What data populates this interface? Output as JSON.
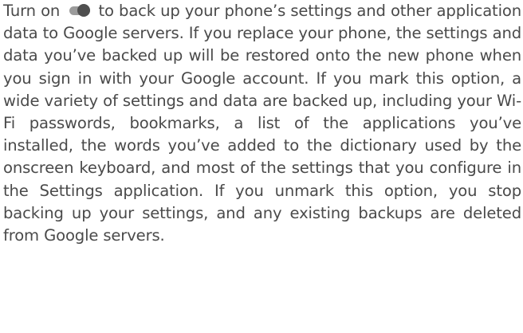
{
  "paragraph": {
    "before_toggle": "Turn on",
    "after_toggle": "to back up your phone’s settings and other application data to Google servers. If you replace your phone, the settings and data you’ve backed up will be restored onto the new phone when you sign in with your Google account. If you mark this option, a wide variety of settings and data are backed up, including your Wi-Fi passwords, bookmarks, a list of the applications you’ve installed, the words you’ve added to the dictionary used by the onscreen keyboard, and most of the settings that you configure in the Settings application. If you unmark this option, you stop backing up your settings, and any existing backups are deleted from Google servers.",
    "toggle_icon": "toggle-switch-icon"
  },
  "colors": {
    "text": "#4a4a4a",
    "toggle_track": "#9b9b9b",
    "toggle_knob": "#4f4f4f"
  }
}
